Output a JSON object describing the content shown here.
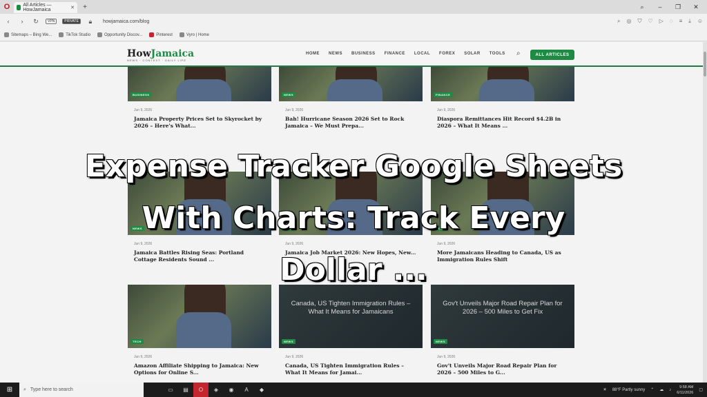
{
  "browser": {
    "tab_title": "All Articles — HowJamaica",
    "url": "howjamaica.com/blog",
    "vpn_label": "VPN",
    "private_label": "PRIVATE",
    "bookmarks": [
      "Sitemaps – Bing We...",
      "TikTok Studio",
      "Opportunity Discov...",
      "Pinterest",
      "Vyro | Home"
    ]
  },
  "site": {
    "logo_main": "How",
    "logo_accent": "Jamaica",
    "tagline": "NEWS · CONTEXT · DAILY LIFE",
    "nav": [
      "HOME",
      "NEWS",
      "BUSINESS",
      "FINANCE",
      "LOCAL",
      "FOREX",
      "SOLAR",
      "TOOLS"
    ],
    "all_articles_label": "ALL ARTICLES"
  },
  "cards": [
    {
      "badge": "BUSINESS",
      "date": "Jun 9, 2026",
      "headline": "Jamaica Property Prices Set to Skyrocket by 2026 – Here's What..."
    },
    {
      "badge": "NEWS",
      "date": "Jun 9, 2026",
      "headline": "Bah! Hurricane Season 2026 Set to Rock Jamaica – We Must Prepa..."
    },
    {
      "badge": "FINANCE",
      "date": "Jun 9, 2026",
      "headline": "Diaspora Remittances Hit Record $4.2B in 2026 – What It Means ..."
    },
    {
      "badge": "NEWS",
      "date": "Jun 9, 2026",
      "headline": "Jamaica Battles Rising Seas: Portland Cottage Residents Sound ..."
    },
    {
      "badge": "NEWS",
      "date": "Jun 9, 2026",
      "headline": "Jamaica Job Market 2026: New Hopes, New..."
    },
    {
      "badge": "NEWS",
      "date": "Jun 9, 2026",
      "headline": "More Jamaicans Heading to Canada, US as Immigration Rules Shift"
    },
    {
      "badge": "TECH",
      "date": "Jun 9, 2026",
      "headline": "Amazon Affiliate Shipping to Jamaica: New Options for Online S..."
    },
    {
      "badge": "NEWS",
      "date": "Jun 9, 2026",
      "headline": "Canada, US Tighten Immigration Rules – What It Means for Jamai...",
      "overlay": "Canada, US Tighten Immigration Rules – What It Means for Jamaicans"
    },
    {
      "badge": "NEWS",
      "date": "Jun 9, 2026",
      "headline": "Gov't Unveils Major Road Repair Plan for 2026 – 500 Miles to G...",
      "overlay": "Gov't Unveils Major Road Repair Plan for 2026 – 500 Miles to Get Fix"
    }
  ],
  "overlay_title": {
    "line1": "Expense Tracker Google Sheets",
    "line2": "With Charts: Track Every",
    "line3": "Dollar ..."
  },
  "taskbar": {
    "search_placeholder": "Type here to search",
    "weather": "88°F Partly sunny",
    "time": "9:58 AM",
    "date": "6/11/2026"
  },
  "colors": {
    "brand_green": "#1e8b45",
    "taskbar": "#1c1c1c"
  }
}
